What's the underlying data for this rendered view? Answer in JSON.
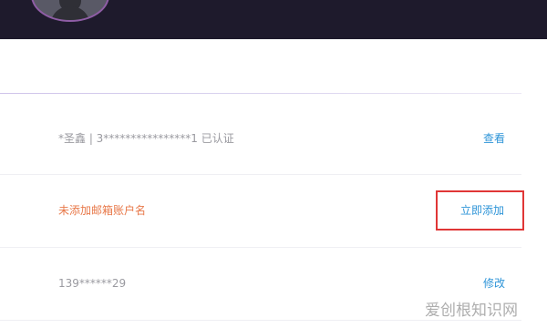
{
  "header": {
    "avatar_icon": "user-avatar-icon"
  },
  "rows": {
    "account": {
      "value": "*圣鑫 | 3****************1 已认证",
      "action": "查看"
    },
    "email": {
      "value": "未添加邮箱账户名",
      "action": "立即添加"
    },
    "phone": {
      "value": "139******29",
      "action": "修改"
    }
  },
  "watermark": "爱创根知识网",
  "colors": {
    "header_background": "#1e1a2c",
    "warning_text": "#e8794a",
    "link": "#2f95d8",
    "highlight_box": "#e03636"
  }
}
